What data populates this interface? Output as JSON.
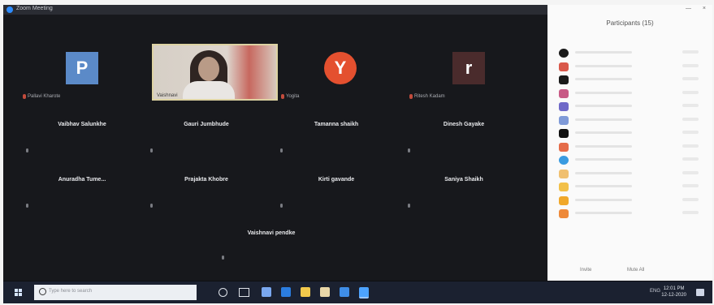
{
  "window": {
    "title": "Zoom Meeting"
  },
  "video_tiles": [
    {
      "initial": "P",
      "color": "#5b8ac8",
      "shape": "square",
      "label": "Pallavi Kharote"
    },
    {
      "label": "Vaishnavi"
    },
    {
      "initial": "Y",
      "color": "#e4502f",
      "shape": "circle",
      "label": "Yogita"
    },
    {
      "initial": "r",
      "color": "#4a2b2c",
      "shape": "square",
      "label": "Ritesh Kadam"
    }
  ],
  "name_tiles": [
    {
      "name": "Vaibhav Salunkhe"
    },
    {
      "name": "Gauri Jumbhude"
    },
    {
      "name": "Tamanna shaikh"
    },
    {
      "name": "Dinesh Gayake"
    },
    {
      "name": "Anuradha Tume..."
    },
    {
      "name": "Prajakta Khobre"
    },
    {
      "name": "Kirti gavande"
    },
    {
      "name": "Saniya Shaikh"
    },
    {
      "name": "Vaishnavi pendke"
    }
  ],
  "participants_panel": {
    "title": "Participants (15)",
    "avatar_colors": [
      "#1a1a1a",
      "#d9584a",
      "#1a1a1a",
      "#c85a86",
      "#6f69c8",
      "#7f9ad8",
      "#111111",
      "#e56c49",
      "#3a9be0",
      "#f0c070",
      "#f2c048",
      "#f0a82a",
      "#ee8a3a"
    ],
    "footer": {
      "invite": "Invite",
      "mute_all": "Mute All"
    }
  },
  "taskbar": {
    "search_placeholder": "Type here to search",
    "time": "12:01 PM",
    "date": "12-12-2020",
    "tray_text": "ENG",
    "app_colors": [
      "#7aa8f0",
      "#2b7de0",
      "#f2c94c",
      "#e9d7a8",
      "#3f8ee8",
      "#4da3ff"
    ]
  }
}
